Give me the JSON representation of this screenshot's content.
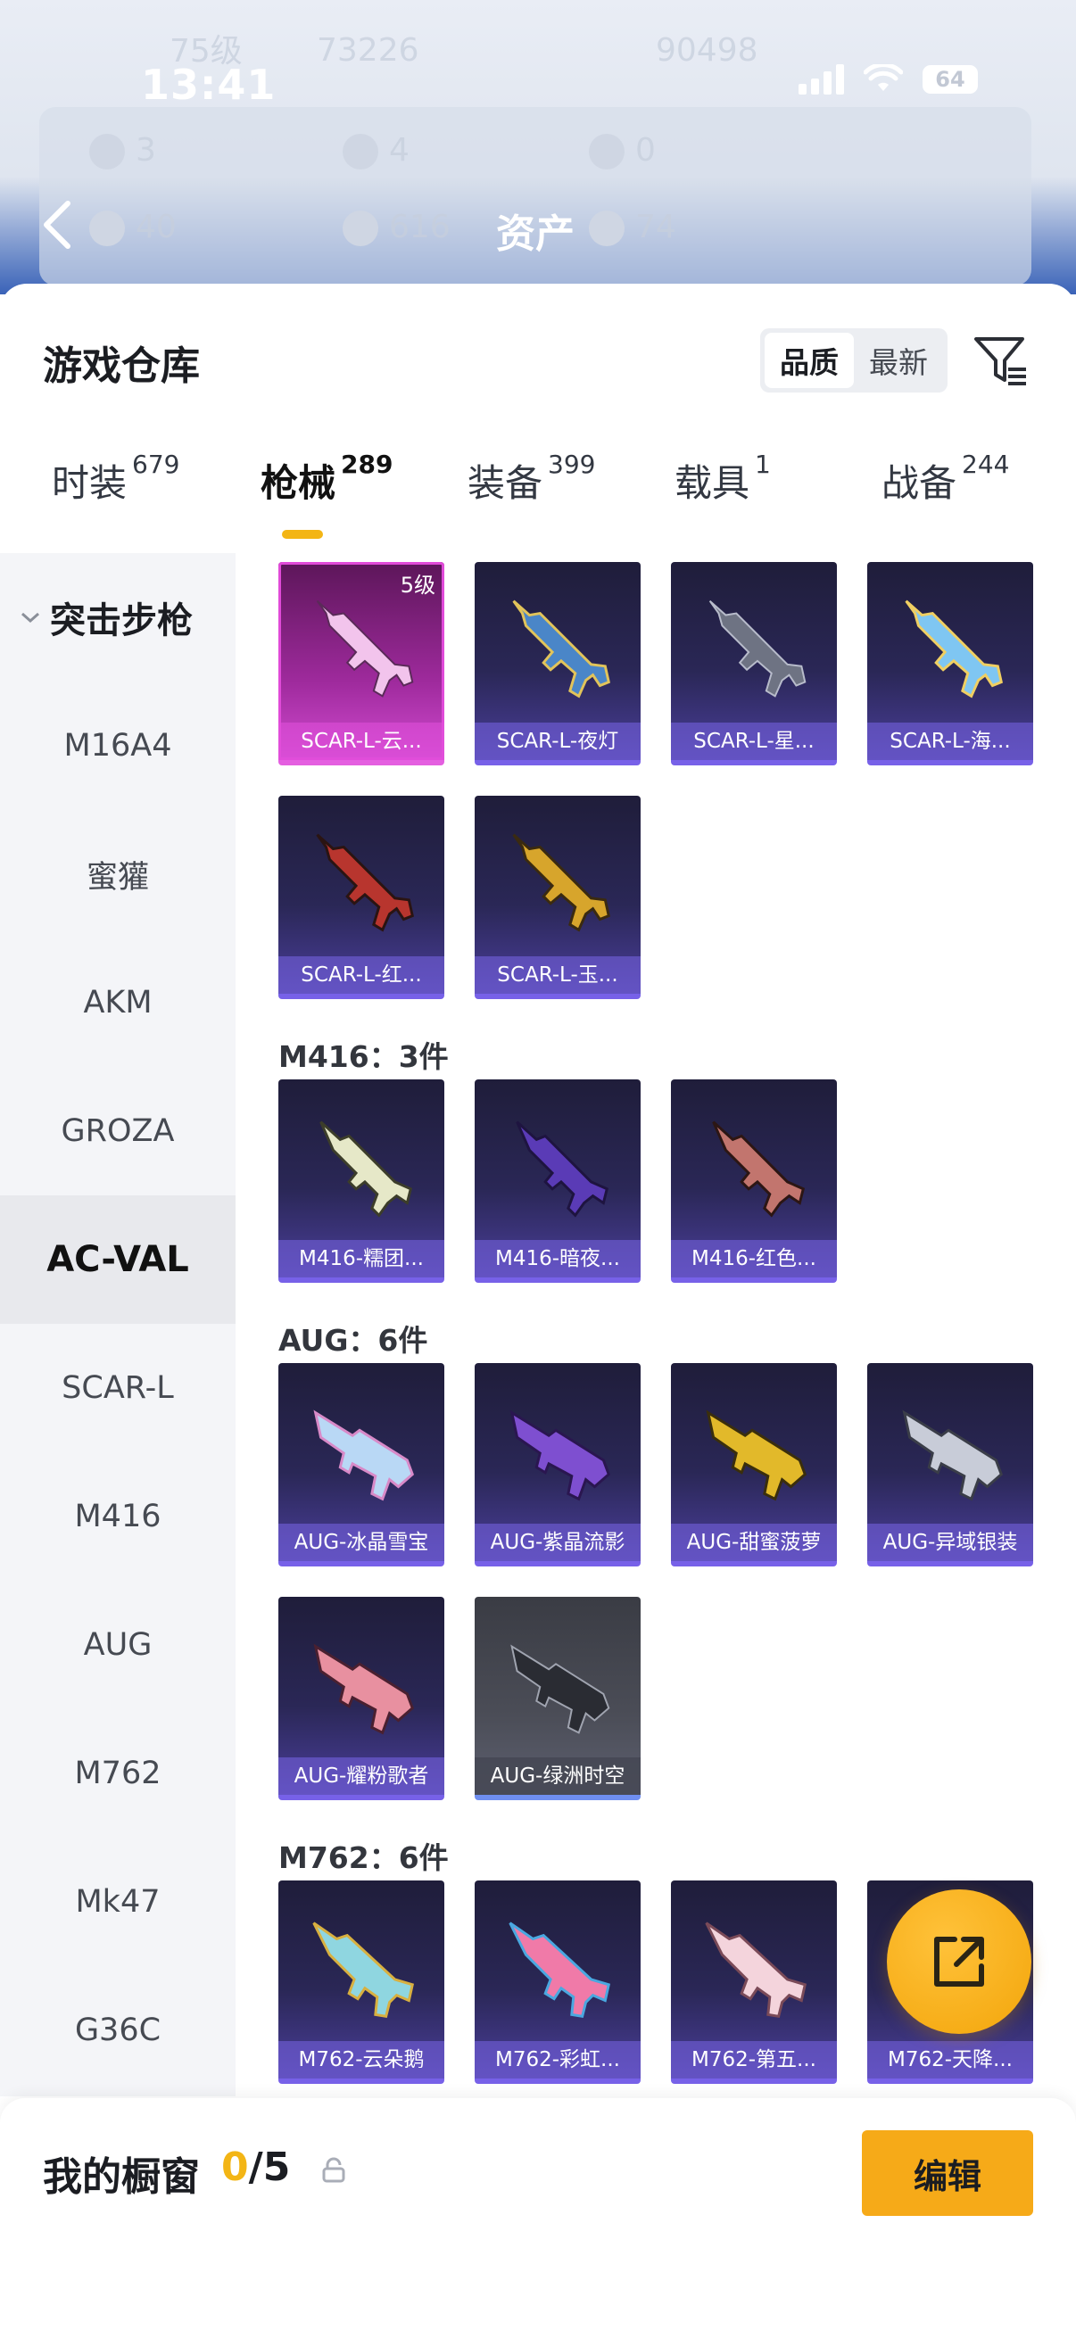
{
  "status_bar": {
    "time": "13:41",
    "battery": "64"
  },
  "profile_bg": {
    "level": "75级",
    "coins": "73226",
    "points": "90498",
    "stats": [
      "3",
      "4",
      "0",
      "40",
      "616",
      "74"
    ]
  },
  "nav": {
    "title": "资产"
  },
  "sheet": {
    "title": "游戏仓库"
  },
  "sort": {
    "quality": "品质",
    "newest": "最新"
  },
  "categories": [
    {
      "label": "时装",
      "count": "679"
    },
    {
      "label": "枪械",
      "count": "289"
    },
    {
      "label": "装备",
      "count": "399"
    },
    {
      "label": "载具",
      "count": "1"
    },
    {
      "label": "战备",
      "count": "244"
    }
  ],
  "sidebar": {
    "group": "突击步枪",
    "items": [
      "M16A4",
      "蜜獾",
      "AKM",
      "GROZA",
      "AC-VAL",
      "SCAR-L",
      "M416",
      "AUG",
      "M762",
      "Mk47",
      "G36C"
    ]
  },
  "groups": {
    "scar": {
      "items": [
        {
          "name": "SCAR-L-云...",
          "level": "5级"
        },
        {
          "name": "SCAR-L-夜灯"
        },
        {
          "name": "SCAR-L-星..."
        },
        {
          "name": "SCAR-L-海..."
        },
        {
          "name": "SCAR-L-红..."
        },
        {
          "name": "SCAR-L-玉..."
        }
      ]
    },
    "m416": {
      "title": "M416：3件",
      "items": [
        "M416-糯团...",
        "M416-暗夜...",
        "M416-红色..."
      ]
    },
    "aug": {
      "title": "AUG：6件",
      "items": [
        "AUG-冰晶雪宝",
        "AUG-紫晶流影",
        "AUG-甜蜜菠萝",
        "AUG-异域银装",
        "AUG-耀粉歌者",
        "AUG-绿洲时空"
      ]
    },
    "m762": {
      "title": "M762：6件",
      "items": [
        "M762-云朵鹅",
        "M762-彩虹...",
        "M762-第五...",
        "M762-天降..."
      ]
    }
  },
  "showcase": {
    "label": "我的橱窗",
    "current": "0",
    "total": "/5",
    "edit": "编辑"
  },
  "colors": {
    "accent": "#f3b515",
    "button": "#f6aa18",
    "card_border": "#7761e8",
    "legendary": "#e04ad8"
  }
}
